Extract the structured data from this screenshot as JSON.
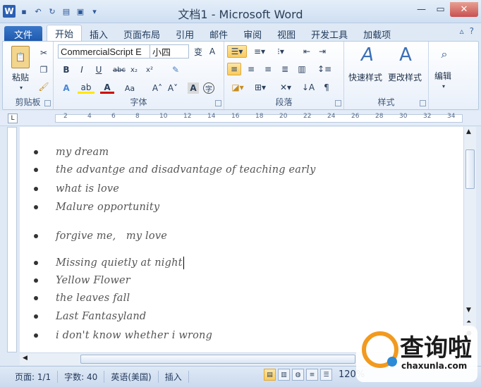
{
  "window": {
    "title": "文档1 - Microsoft Word"
  },
  "tabs": [
    {
      "label": "文件"
    },
    {
      "label": "开始"
    },
    {
      "label": "插入"
    },
    {
      "label": "页面布局"
    },
    {
      "label": "引用"
    },
    {
      "label": "邮件"
    },
    {
      "label": "审阅"
    },
    {
      "label": "视图"
    },
    {
      "label": "开发工具"
    },
    {
      "label": "加载项"
    }
  ],
  "ribbon": {
    "clipboard": {
      "label": "剪贴板",
      "paste": "粘贴"
    },
    "font": {
      "label": "字体",
      "name": "CommercialScript E",
      "size": "小四"
    },
    "paragraph": {
      "label": "段落"
    },
    "styles": {
      "label": "样式",
      "quick": "快速样式",
      "change": "更改样式"
    },
    "edit": {
      "label": "编辑"
    }
  },
  "document": {
    "lines": [
      "my dream",
      "the advantge and disadvantage of teaching early",
      "what is love",
      "Malure opportunity",
      "forgive me,   my love",
      "Missing quietly at night",
      "Yellow Flower",
      "the leaves fall",
      "Last Fantasyland",
      "i don't know whether i wrong"
    ]
  },
  "status": {
    "page": "页面: 1/1",
    "words": "字数: 40",
    "lang": "英语(美国)",
    "mode": "插入",
    "zoom": "120%"
  },
  "watermark": {
    "text": "查询啦",
    "sub": "chaxunla.com"
  }
}
